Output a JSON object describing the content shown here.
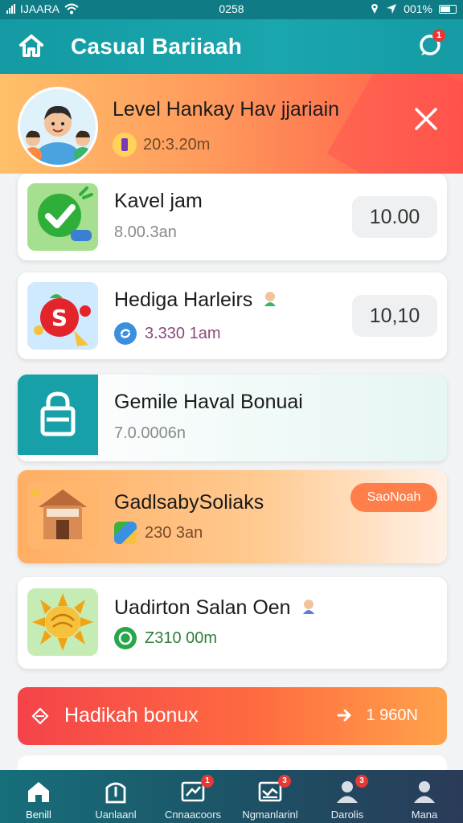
{
  "status_bar": {
    "carrier": "IJAARA",
    "time": "0258",
    "battery": "001%"
  },
  "header": {
    "title": "Casual Bariiaah",
    "chat_badge": "1"
  },
  "banner": {
    "title": "Level Hankay Hav jjariain",
    "subtitle": "20:3.20m"
  },
  "items": [
    {
      "title": "Kavel jam",
      "subtitle": "8.00.3an",
      "action": "10.00"
    },
    {
      "title": "Hediga Harleirs",
      "subtitle": "3.330 1am",
      "action": "10,10"
    },
    {
      "title": "Gemile Haval Bonuai",
      "subtitle": "7.0.0006n",
      "action": ""
    },
    {
      "title": "GadlsabySoliaks",
      "subtitle": "230 3an",
      "action": "SaoNoah"
    },
    {
      "title": "Uadirton Salan Oen",
      "subtitle": "Z310 00m",
      "action": ""
    }
  ],
  "bonus_bar": {
    "label": "Hadikah bonux",
    "value": "1 960N"
  },
  "tabs": [
    {
      "label": "Benill",
      "badge": ""
    },
    {
      "label": "Uanlaanl",
      "badge": ""
    },
    {
      "label": "Cnnaacoors",
      "badge": "1"
    },
    {
      "label": "Ngmanlarinl",
      "badge": "3"
    },
    {
      "label": "Darolis",
      "badge": "3"
    },
    {
      "label": "Mana",
      "badge": ""
    }
  ],
  "colors": {
    "header": "#139aa3",
    "banner_start": "#ffc06a",
    "banner_end": "#ff5a4a",
    "accent_orange": "#ff7f4a",
    "bonus_start": "#f4434a",
    "bonus_end": "#ffa24a",
    "tab_bar": "#1e4e63"
  }
}
